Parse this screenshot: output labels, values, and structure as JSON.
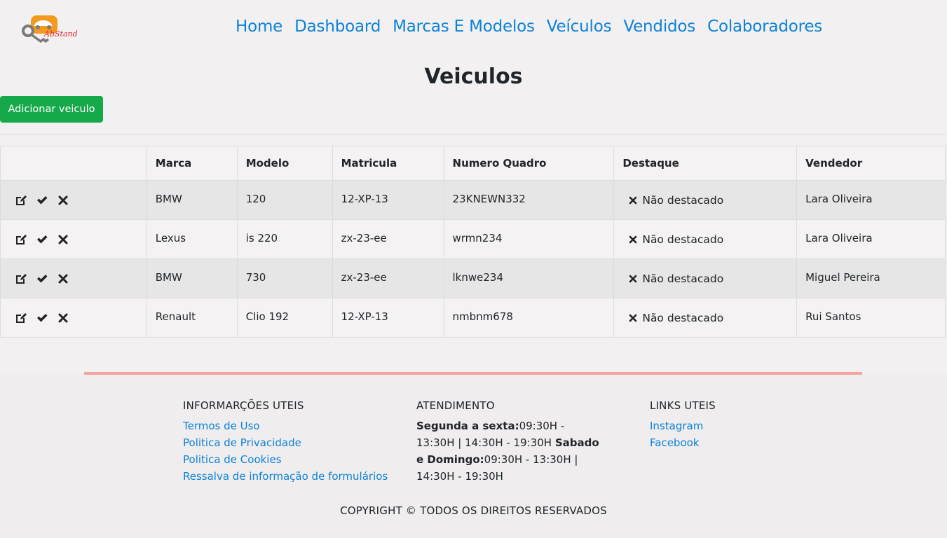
{
  "logo": {
    "text": "AbStand",
    "colors": {
      "orange": "#f39a1e",
      "red": "#e0262f",
      "grey": "#7a7a7a"
    }
  },
  "nav": {
    "items": [
      "Home",
      "Dashboard",
      "Marcas E Modelos",
      "Veículos",
      "Vendidos",
      "Colaboradores"
    ]
  },
  "page": {
    "title": "Veiculos",
    "add_button": "Adicionar veiculo"
  },
  "table": {
    "headers": [
      "",
      "Marca",
      "Modelo",
      "Matricula",
      "Numero Quadro",
      "Destaque",
      "Vendedor"
    ],
    "rows": [
      {
        "marca": "BMW",
        "modelo": "120",
        "matricula": "12-XP-13",
        "quadro": "23KNEWN332",
        "destaque": "Não destacado",
        "vendedor": "Lara Oliveira"
      },
      {
        "marca": "Lexus",
        "modelo": "is 220",
        "matricula": "zx-23-ee",
        "quadro": "wrmn234",
        "destaque": "Não destacado",
        "vendedor": "Lara Oliveira"
      },
      {
        "marca": "BMW",
        "modelo": "730",
        "matricula": "zx-23-ee",
        "quadro": "lknwe234",
        "destaque": "Não destacado",
        "vendedor": "Miguel Pereira"
      },
      {
        "marca": "Renault",
        "modelo": "Clio 192",
        "matricula": "12-XP-13",
        "quadro": "nmbnm678",
        "destaque": "Não destacado",
        "vendedor": "Rui Santos"
      }
    ],
    "row_icons": [
      "edit-icon",
      "check-icon",
      "close-icon"
    ]
  },
  "footer": {
    "info": {
      "title": "INFORMARÇÕES UTEIS",
      "links": [
        "Termos de Uso",
        "Politica de Privacidade",
        "Politica de Cookies",
        "Ressalva de informação de formulários"
      ]
    },
    "atendimento": {
      "title": "ATENDIMENTO",
      "weekday_label": "Segunda a sexta:",
      "weekday_hours": "09:30H - 13:30H | 14:30H - 19:30H",
      "weekend_label": "Sabado e Domingo:",
      "weekend_hours": "09:30H - 13:30H | 14:30H - 19:30H"
    },
    "links": {
      "title": "LINKS UTEIS",
      "items": [
        "Instagram",
        "Facebook"
      ]
    },
    "copyright": "COPYRIGHT © TODOS OS DIREITOS RESERVADOS"
  },
  "colors": {
    "link": "#0d82d8",
    "button": "#16a94a",
    "accent_line": "#f4a59e"
  }
}
